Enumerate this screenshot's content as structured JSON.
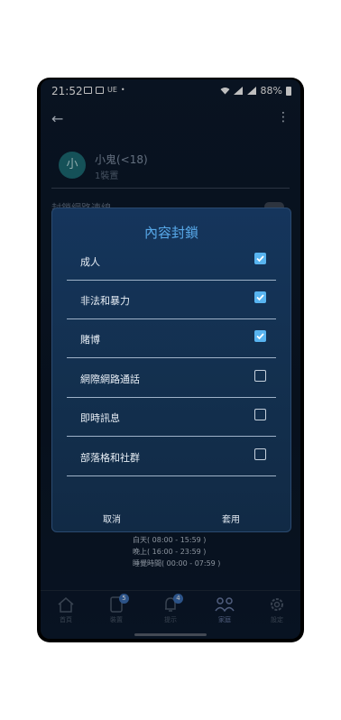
{
  "status": {
    "time": "21:52",
    "carrier": "UE",
    "battery": "88%"
  },
  "profile": {
    "avatar_letter": "小",
    "name": "小鬼(<18)",
    "devices": "1裝置"
  },
  "settings": {
    "block_network": "封鎖網路連線",
    "schedule": [
      "白天( 08:00 - 15:59 )",
      "晚上( 16:00 - 23:59 )",
      "睡覺時間( 00:00 - 07:59 )"
    ]
  },
  "dialog": {
    "title": "內容封鎖",
    "items": [
      {
        "label": "成人",
        "checked": true
      },
      {
        "label": "非法和暴力",
        "checked": true
      },
      {
        "label": "賭博",
        "checked": true
      },
      {
        "label": "網際網路通話",
        "checked": false
      },
      {
        "label": "即時訊息",
        "checked": false
      },
      {
        "label": "部落格和社群",
        "checked": false
      }
    ],
    "cancel": "取消",
    "apply": "套用"
  },
  "nav": {
    "items": [
      {
        "label": "首頁",
        "badge": ""
      },
      {
        "label": "裝置",
        "badge": "5"
      },
      {
        "label": "提示",
        "badge": "4"
      },
      {
        "label": "家庭",
        "badge": ""
      },
      {
        "label": "設定",
        "badge": ""
      }
    ],
    "active": "家庭"
  },
  "colors": {
    "accent": "#58a9ea",
    "checkbox_on": "#58b4f0",
    "dialog_bg": "#15355c"
  },
  "icons": [
    "back-arrow-icon",
    "more-vert-icon",
    "home-icon",
    "device-icon",
    "bell-icon",
    "family-icon",
    "gear-icon"
  ]
}
